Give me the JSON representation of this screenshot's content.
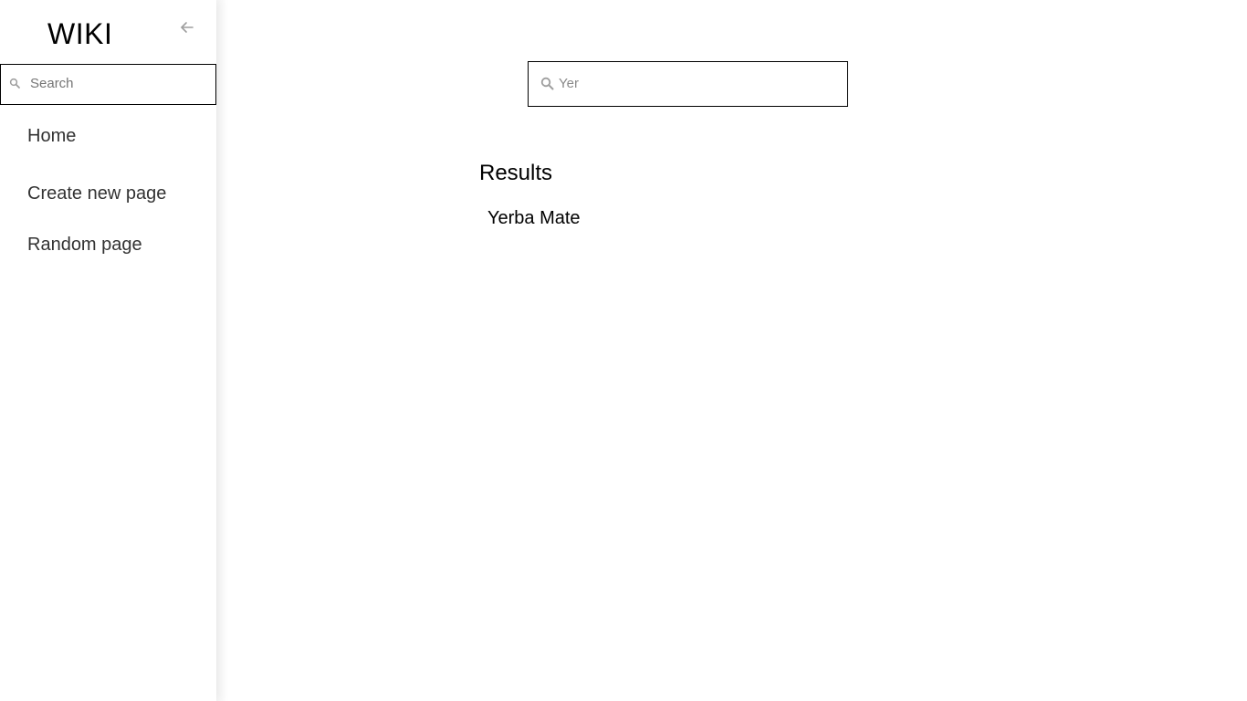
{
  "sidebar": {
    "brand": "WIKI",
    "collapse_icon": "arrow-left-icon",
    "search": {
      "placeholder": "Search",
      "value": "",
      "icon": "search-icon"
    },
    "items": [
      {
        "label": "Home"
      },
      {
        "label": "Create new page"
      },
      {
        "label": "Random page"
      }
    ]
  },
  "main": {
    "search": {
      "value": "Yer",
      "icon": "search-icon"
    },
    "results_heading": "Results",
    "results": [
      {
        "title": "Yerba Mate"
      }
    ]
  },
  "colors": {
    "background": "#ffffff",
    "text": "#000000",
    "nav_text": "#333333",
    "muted_icon": "#9e9e9e",
    "border": "#000000"
  }
}
